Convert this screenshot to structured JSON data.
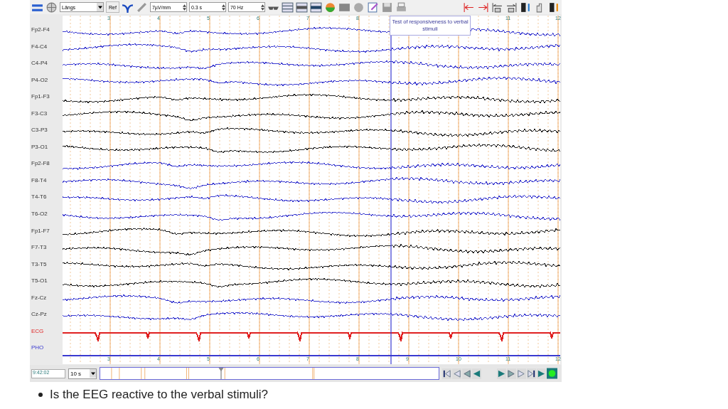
{
  "toolbar": {
    "montage": "Längs",
    "ref_button": "Ref",
    "sensitivity": "7µV/mm",
    "time_constant": "0.3 s",
    "filter": "70 Hz"
  },
  "top_ticks": [
    "3",
    "4",
    "5",
    "6",
    "7",
    "8",
    "11",
    "12"
  ],
  "channels": [
    {
      "name": "Fp2-F4",
      "color": "#3a3ad0",
      "kind": "eeg"
    },
    {
      "name": "F4-C4",
      "color": "#3a3ad0",
      "kind": "eeg"
    },
    {
      "name": "C4-P4",
      "color": "#3a3ad0",
      "kind": "eeg"
    },
    {
      "name": "P4-O2",
      "color": "#3a3ad0",
      "kind": "eeg"
    },
    {
      "name": "Fp1-F3",
      "color": "#222222",
      "kind": "eeg"
    },
    {
      "name": "F3-C3",
      "color": "#222222",
      "kind": "eeg"
    },
    {
      "name": "C3-P3",
      "color": "#222222",
      "kind": "eeg"
    },
    {
      "name": "P3-O1",
      "color": "#222222",
      "kind": "eeg"
    },
    {
      "name": "Fp2-F8",
      "color": "#3a3ad0",
      "kind": "eeg"
    },
    {
      "name": "F8-T4",
      "color": "#3a3ad0",
      "kind": "eeg"
    },
    {
      "name": "T4-T6",
      "color": "#3a3ad0",
      "kind": "eeg"
    },
    {
      "name": "T6-O2",
      "color": "#3a3ad0",
      "kind": "eeg"
    },
    {
      "name": "Fp1-F7",
      "color": "#222222",
      "kind": "eeg"
    },
    {
      "name": "F7-T3",
      "color": "#222222",
      "kind": "eeg"
    },
    {
      "name": "T3-T5",
      "color": "#222222",
      "kind": "eeg"
    },
    {
      "name": "T5-O1",
      "color": "#222222",
      "kind": "eeg"
    },
    {
      "name": "Fz-Cz",
      "color": "#3a3ad0",
      "kind": "eeg"
    },
    {
      "name": "Cz-Pz",
      "color": "#3a3ad0",
      "kind": "eeg"
    },
    {
      "name": "ECG",
      "color": "#e02020",
      "kind": "ecg"
    },
    {
      "name": "PHO",
      "color": "#3a3ad0",
      "kind": "pho"
    }
  ],
  "annotation": "Test of responsiveness to verbal stimuli",
  "bottom_ticks": [
    "3",
    "4",
    "5",
    "6",
    "7",
    "8",
    "9",
    "10",
    "11",
    "12"
  ],
  "navigation": {
    "time": "9:42:02",
    "page_length": "10 s"
  },
  "bullet": "Is the EEG reactive to the verbal stimuli?"
}
